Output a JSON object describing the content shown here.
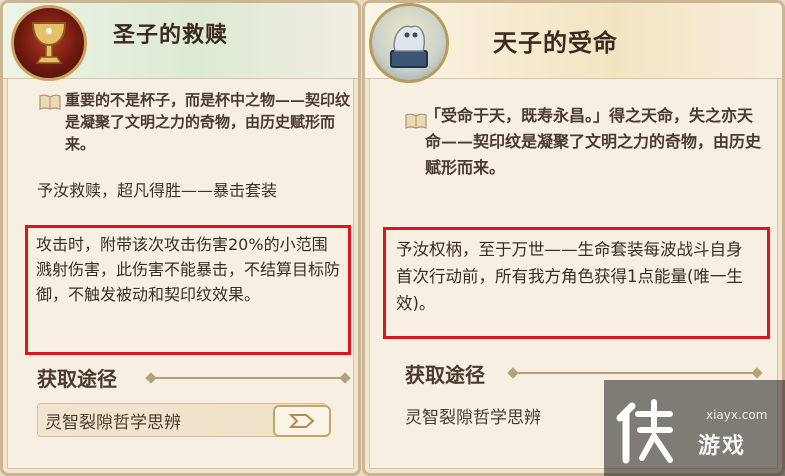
{
  "left_card": {
    "title": "圣子的救赎",
    "description": "重要的不是杯子，而是杯中之物——契印纹是凝聚了文明之力的奇物，由历史赋形而来。",
    "set_title": "予汝救赎，超凡得胜——暴击套装",
    "effect": "攻击时，附带该次攻击伤害20%的小范围溅射伤害，此伤害不能暴击，不结算目标防御，不触发被动和契印纹效果。",
    "acquire_label": "获取途径",
    "source": "灵智裂隙哲学思辨"
  },
  "right_card": {
    "title": "天子的受命",
    "description": "「受命于天，既寿永昌。」得之天命，失之亦天命——契印纹是凝聚了文明之力的奇物，由历史赋形而来。",
    "effect": "予汝权柄，至于万世——生命套装每波战斗自身首次行动前，所有我方角色获得1点能量(唯一生效)。",
    "acquire_label": "获取途径",
    "source": "灵智裂隙哲学思辨"
  },
  "watermark": {
    "url": "xiayx.com",
    "name": "游戏",
    "logo_glyph": "侠"
  }
}
